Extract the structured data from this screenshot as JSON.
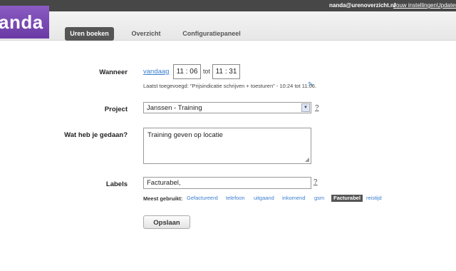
{
  "topbar": {
    "user": "nanda@urenoverzicht.nl",
    "settings_link": "Jouw instellingen",
    "updates_link": "Updates"
  },
  "logo": {
    "text": "anda"
  },
  "nav": {
    "tabs": [
      {
        "label": "Uren boeken",
        "active": true
      },
      {
        "label": "Overzicht",
        "active": false
      },
      {
        "label": "Configuratiepaneel",
        "active": false
      }
    ]
  },
  "form": {
    "wanneer": {
      "label": "Wanneer",
      "date_link": "vandaag",
      "start_time": "11 : 06",
      "separator": "tot",
      "end_time": "11 : 31",
      "last_added": "Laatst toegevoegd: \"Prijsindicatie schrijven + toesturen\" - 10:24 tot 11:06."
    },
    "project": {
      "label": "Project",
      "selected": "Janssen - Training",
      "help": "?"
    },
    "gedaan": {
      "label": "Wat heb je gedaan?",
      "value": "Training geven op locatie"
    },
    "labels": {
      "label": "Labels",
      "value": "Facturabel,",
      "help": "?",
      "most_used_label": "Meest gebruikt:",
      "tags": [
        {
          "label": "Gefactureerd",
          "selected": false
        },
        {
          "label": "telefoon",
          "selected": false
        },
        {
          "label": "uitgaand",
          "selected": false
        },
        {
          "label": "inkomend",
          "selected": false
        },
        {
          "label": "gsm",
          "selected": false
        },
        {
          "label": "Facturabel",
          "selected": true
        },
        {
          "label": "reistijd",
          "selected": false
        }
      ]
    },
    "save_label": "Opslaan"
  },
  "icons": {
    "edit": "pencil-icon",
    "select_arrow": "chevron-down-icon",
    "resize": "resize-grip-icon"
  },
  "colors": {
    "topbar": "#474747",
    "logo": "#7a4bb4",
    "link": "#3a7fcf",
    "active_tab": "#555555"
  }
}
